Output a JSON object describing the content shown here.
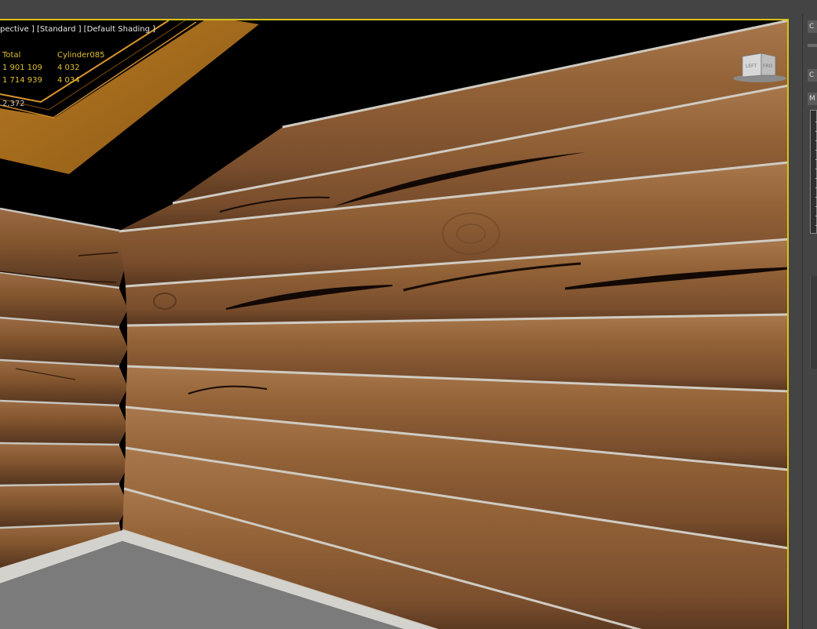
{
  "viewport": {
    "label": "pective ] [Standard ] [Default Shading ]",
    "stats": {
      "rows": [
        {
          "col1": "Total",
          "col2": "Cylinder085"
        },
        {
          "col1": "1 901 109",
          "col2": "4 032"
        },
        {
          "col1": "1 714 939",
          "col2": "4 034"
        }
      ],
      "extra": "2,372"
    },
    "viewcube": {
      "left_label": "LEFT",
      "right_label": "FRO"
    }
  },
  "right_panel": {
    "tabs": [
      "C",
      "",
      "C",
      "M"
    ]
  },
  "colors": {
    "selection_border": "#d8c21a",
    "stats_text": "#e0c030",
    "ceiling_trim": "#a86e1e",
    "wood_base": "#8a5a35",
    "gap": "#c8c4bc",
    "floor": "#7a7a7a"
  }
}
